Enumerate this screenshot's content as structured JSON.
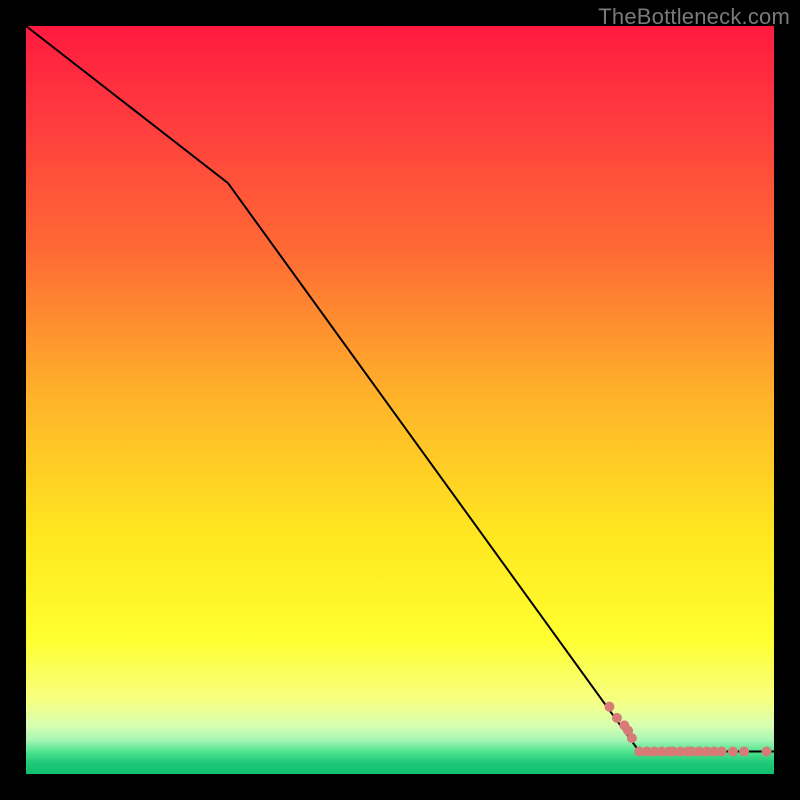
{
  "attribution": "TheBottleneck.com",
  "chart_data": {
    "type": "line",
    "title": "",
    "xlabel": "",
    "ylabel": "",
    "xlim": [
      0,
      100
    ],
    "ylim": [
      0,
      100
    ],
    "grid": false,
    "legend": false,
    "background": {
      "type": "vertical-rainbow",
      "stops": [
        {
          "pos": 0.0,
          "color": "#ff1a3f"
        },
        {
          "pos": 0.12,
          "color": "#ff3a3f"
        },
        {
          "pos": 0.3,
          "color": "#ff6a34"
        },
        {
          "pos": 0.5,
          "color": "#ffb42a"
        },
        {
          "pos": 0.68,
          "color": "#ffe720"
        },
        {
          "pos": 0.82,
          "color": "#ffff30"
        },
        {
          "pos": 0.9,
          "color": "#f7ff80"
        },
        {
          "pos": 0.935,
          "color": "#d8ffb0"
        },
        {
          "pos": 0.955,
          "color": "#a6f5b4"
        },
        {
          "pos": 0.97,
          "color": "#4fe38f"
        },
        {
          "pos": 0.985,
          "color": "#1fc978"
        },
        {
          "pos": 1.0,
          "color": "#0fbf70"
        }
      ]
    },
    "series": [
      {
        "name": "bottleneck-curve",
        "type": "line",
        "color": "#000000",
        "width": 2,
        "x": [
          0,
          27,
          82,
          100
        ],
        "y": [
          100,
          79,
          3,
          3
        ]
      },
      {
        "name": "data-points",
        "type": "scatter",
        "color": "#d87b78",
        "radius": 5,
        "points": [
          {
            "x": 78,
            "y": 9.0
          },
          {
            "x": 79,
            "y": 7.5
          },
          {
            "x": 80,
            "y": 6.5
          },
          {
            "x": 80.5,
            "y": 5.8
          },
          {
            "x": 81,
            "y": 4.8
          },
          {
            "x": 82,
            "y": 3.0
          },
          {
            "x": 83,
            "y": 3.0
          },
          {
            "x": 84,
            "y": 3.0
          },
          {
            "x": 85,
            "y": 3.0
          },
          {
            "x": 86,
            "y": 3.0
          },
          {
            "x": 86.5,
            "y": 3.0
          },
          {
            "x": 87.5,
            "y": 3.0
          },
          {
            "x": 88.5,
            "y": 3.0
          },
          {
            "x": 89,
            "y": 3.0
          },
          {
            "x": 90,
            "y": 3.0
          },
          {
            "x": 91,
            "y": 3.0
          },
          {
            "x": 92,
            "y": 3.0
          },
          {
            "x": 93,
            "y": 3.0
          },
          {
            "x": 94.5,
            "y": 3.0
          },
          {
            "x": 96,
            "y": 3.0
          },
          {
            "x": 99,
            "y": 3.0
          }
        ]
      }
    ]
  }
}
